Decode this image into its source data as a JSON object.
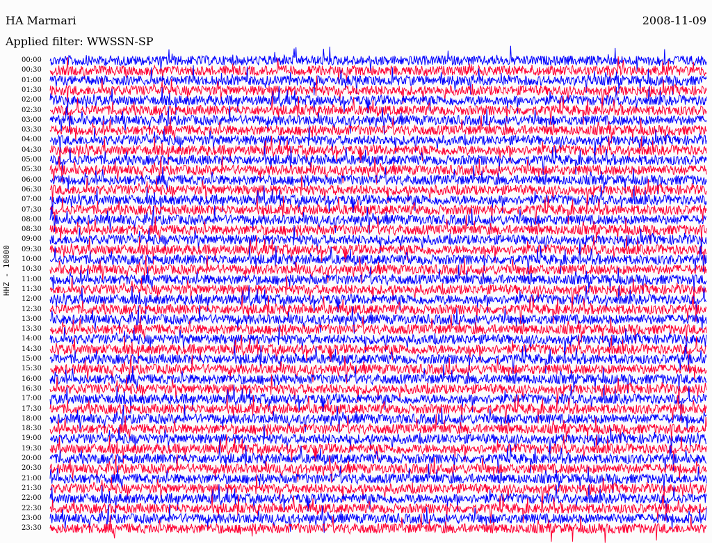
{
  "header": {
    "station": "HA Marmari",
    "date": "2008-11-09",
    "filter": "Applied filter: WWSSN-SP"
  },
  "channel_label": "HHZ - 10000",
  "colors": {
    "trace_a": "#0000ff",
    "trace_b": "#ff0033",
    "background": "#fcfcfc"
  },
  "time_labels": [
    "00:00",
    "00:30",
    "01:00",
    "01:30",
    "02:00",
    "02:30",
    "03:00",
    "03:30",
    "04:00",
    "04:30",
    "05:00",
    "05:30",
    "06:00",
    "06:30",
    "07:00",
    "07:30",
    "08:00",
    "08:30",
    "09:00",
    "09:30",
    "10:00",
    "10:30",
    "11:00",
    "11:30",
    "12:00",
    "12:30",
    "13:00",
    "13:30",
    "14:00",
    "14:30",
    "15:00",
    "15:30",
    "16:00",
    "16:30",
    "17:00",
    "17:30",
    "18:00",
    "18:30",
    "19:00",
    "19:30",
    "20:00",
    "20:30",
    "21:00",
    "21:30",
    "22:00",
    "22:30",
    "23:00",
    "23:30"
  ]
}
